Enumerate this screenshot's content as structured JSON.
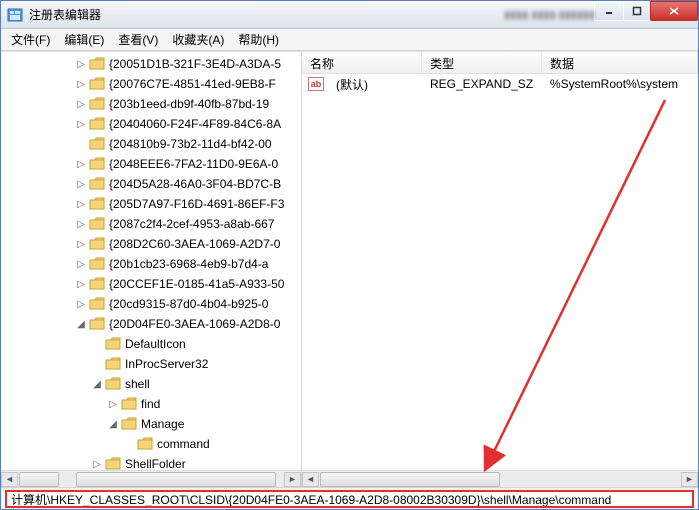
{
  "window": {
    "title": "注册表编辑器"
  },
  "menubar": {
    "file": "文件(F)",
    "edit": "编辑(E)",
    "view": "查看(V)",
    "favorites": "收藏夹(A)",
    "help": "帮助(H)"
  },
  "tree": {
    "items": [
      {
        "indent": 4,
        "exp": "▷",
        "label": "{20051D1B-321F-3E4D-A3DA-5"
      },
      {
        "indent": 4,
        "exp": "▷",
        "label": "{20076C7E-4851-41ed-9EB8-F"
      },
      {
        "indent": 4,
        "exp": "▷",
        "label": "{203b1eed-db9f-40fb-87bd-19"
      },
      {
        "indent": 4,
        "exp": "▷",
        "label": "{20404060-F24F-4F89-84C6-8A"
      },
      {
        "indent": 4,
        "exp": " ",
        "label": "{204810b9-73b2-11d4-bf42-00"
      },
      {
        "indent": 4,
        "exp": "▷",
        "label": "{2048EEE6-7FA2-11D0-9E6A-0"
      },
      {
        "indent": 4,
        "exp": "▷",
        "label": "{204D5A28-46A0-3F04-BD7C-B"
      },
      {
        "indent": 4,
        "exp": "▷",
        "label": "{205D7A97-F16D-4691-86EF-F3"
      },
      {
        "indent": 4,
        "exp": "▷",
        "label": "{2087c2f4-2cef-4953-a8ab-667"
      },
      {
        "indent": 4,
        "exp": "▷",
        "label": "{208D2C60-3AEA-1069-A2D7-0"
      },
      {
        "indent": 4,
        "exp": "▷",
        "label": "{20b1cb23-6968-4eb9-b7d4-a"
      },
      {
        "indent": 4,
        "exp": "▷",
        "label": "{20CCEF1E-0185-41a5-A933-50"
      },
      {
        "indent": 4,
        "exp": "▷",
        "label": "{20cd9315-87d0-4b04-b925-0"
      },
      {
        "indent": 4,
        "exp": "◢",
        "label": "{20D04FE0-3AEA-1069-A2D8-0"
      },
      {
        "indent": 5,
        "exp": " ",
        "label": "DefaultIcon"
      },
      {
        "indent": 5,
        "exp": " ",
        "label": "InProcServer32"
      },
      {
        "indent": 5,
        "exp": "◢",
        "label": "shell"
      },
      {
        "indent": 6,
        "exp": "▷",
        "label": "find"
      },
      {
        "indent": 6,
        "exp": "◢",
        "label": "Manage"
      },
      {
        "indent": 7,
        "exp": " ",
        "label": "command"
      },
      {
        "indent": 5,
        "exp": "▷",
        "label": "ShellFolder"
      }
    ]
  },
  "list": {
    "columns": {
      "name": "名称",
      "type": "类型",
      "data": "数据"
    },
    "rows": [
      {
        "icon": "ab",
        "name": "(默认)",
        "type": "REG_EXPAND_SZ",
        "data": "%SystemRoot%\\system"
      }
    ]
  },
  "statusbar": {
    "path": "计算机\\HKEY_CLASSES_ROOT\\CLSID\\{20D04FE0-3AEA-1069-A2D8-08002B30309D}\\shell\\Manage\\command"
  }
}
